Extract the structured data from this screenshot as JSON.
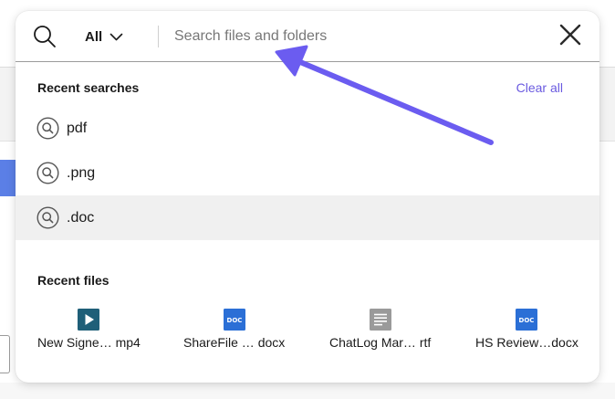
{
  "search": {
    "scope_label": "All",
    "placeholder": "Search files and folders",
    "value": ""
  },
  "recent_searches": {
    "title": "Recent searches",
    "clear_label": "Clear all",
    "items": [
      {
        "label": "pdf"
      },
      {
        "label": ".png"
      },
      {
        "label": ".doc"
      }
    ]
  },
  "recent_files": {
    "title": "Recent files",
    "items": [
      {
        "name": "New Signe… mp4",
        "icon": "video-file-icon"
      },
      {
        "name": "ShareFile … docx",
        "icon": "doc-file-icon",
        "badge": "DOC"
      },
      {
        "name": "ChatLog Mar… rtf",
        "icon": "text-file-icon"
      },
      {
        "name": "HS Review…docx",
        "icon": "doc-file-icon",
        "badge": "DOC"
      }
    ]
  },
  "colors": {
    "accent": "#6a5ae0",
    "arrow": "#6b5cf0",
    "doc_blue": "#2b6fd6",
    "video_teal": "#1f5f78",
    "text_gray": "#9a9a9a"
  }
}
